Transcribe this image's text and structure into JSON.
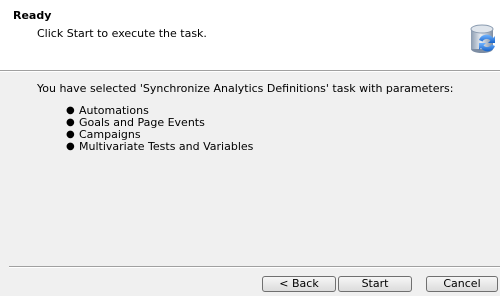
{
  "header": {
    "title": "Ready",
    "subtitle": "Click Start to execute the task.",
    "icon": "database-sync-icon"
  },
  "main": {
    "intro_text": "You have selected 'Synchronize Analytics Definitions' task with parameters:",
    "parameters": [
      "Automations",
      "Goals and Page Events",
      "Campaigns",
      "Multivariate Tests and Variables"
    ]
  },
  "footer": {
    "back_label": "< Back",
    "start_label": "Start",
    "cancel_label": "Cancel"
  }
}
